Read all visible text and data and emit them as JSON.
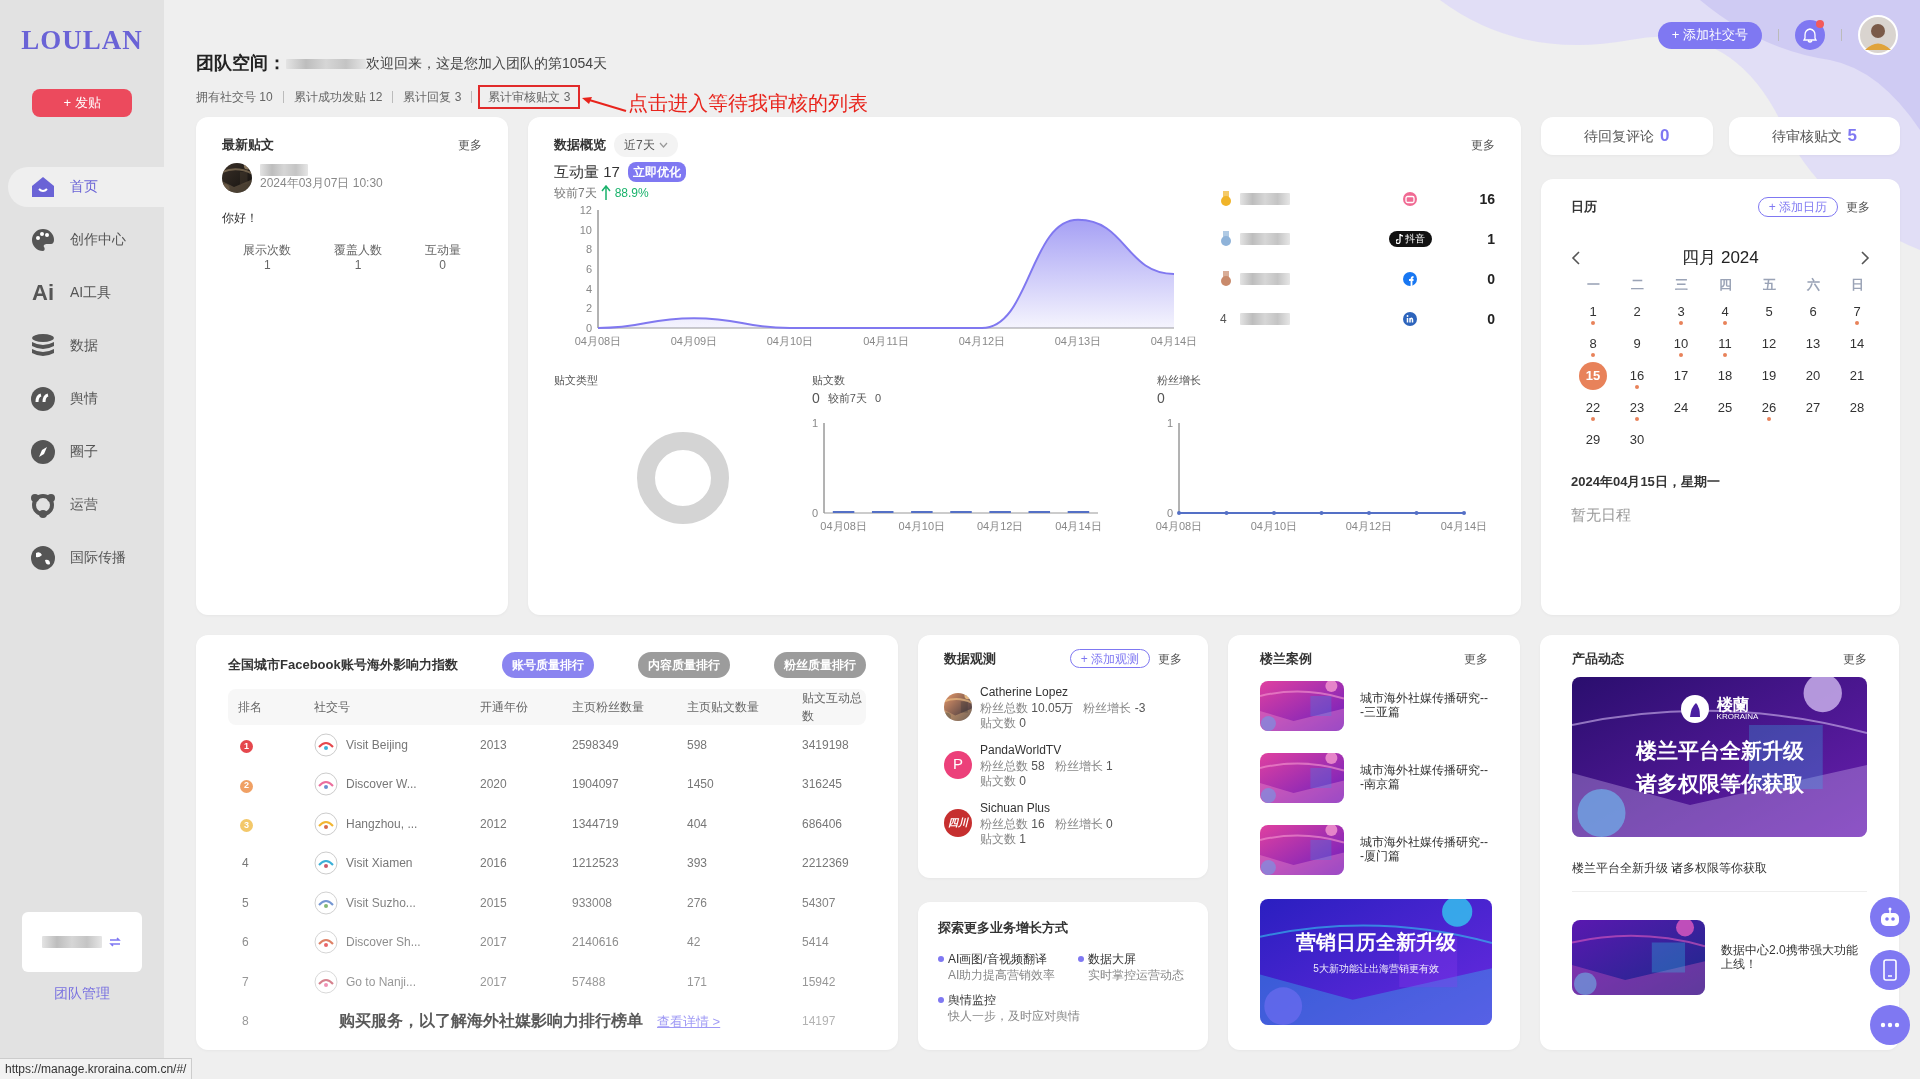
{
  "sidebar": {
    "logo": "LOULAN",
    "post_button": "+ 发贴",
    "items": [
      {
        "label": "首页",
        "selected": true
      },
      {
        "label": "创作中心",
        "selected": false
      },
      {
        "label": "AI工具",
        "selected": false,
        "glyph": "Ai"
      },
      {
        "label": "数据",
        "selected": false
      },
      {
        "label": "舆情",
        "selected": false
      },
      {
        "label": "圈子",
        "selected": false
      },
      {
        "label": "运营",
        "selected": false
      },
      {
        "label": "国际传播",
        "selected": false
      }
    ],
    "team_link": "团队管理"
  },
  "topbar": {
    "add_button": "+ 添加社交号",
    "unread": true
  },
  "header": {
    "title": "团队空间：",
    "welcome": "欢迎回来，这是您加入团队的第1054天",
    "stats": [
      {
        "text": "拥有社交号 10",
        "highlighted": false
      },
      {
        "text": "累计成功发贴 12",
        "highlighted": false
      },
      {
        "text": "累计回复 3",
        "highlighted": false
      },
      {
        "text": "累计审核贴文 3",
        "highlighted": true
      }
    ],
    "annotation": "点击进入等待我审核的列表"
  },
  "latest_post": {
    "title": "最新贴文",
    "more": "更多",
    "time": "2024年03月07日 10:30",
    "content": "你好！",
    "metrics": [
      {
        "label": "展示次数",
        "value": "1"
      },
      {
        "label": "覆盖人数",
        "value": "1"
      },
      {
        "label": "互动量",
        "value": "0"
      }
    ]
  },
  "overview": {
    "title": "数据概览",
    "range": "近7天",
    "more": "更多",
    "metric_label": "互动量 17",
    "optimize_button": "立即优化",
    "compare_label": "较前7天",
    "change": "88.9%",
    "rising": true,
    "chart_data": {
      "type": "area",
      "categories": [
        "04月08日",
        "04月09日",
        "04月10日",
        "04月11日",
        "04月12日",
        "04月13日",
        "04月14日"
      ],
      "series": [
        {
          "color": "#8078f0",
          "values": [
            0,
            1,
            0,
            0,
            0,
            11,
            5.5
          ]
        }
      ],
      "ylim": [
        0,
        12
      ],
      "yticks": [
        0,
        2,
        4,
        6,
        8,
        10,
        12
      ]
    },
    "leaderboard": [
      {
        "kind": "medal",
        "color": "#f0b429",
        "platform": {
          "kind": "tv"
        },
        "value": "16"
      },
      {
        "kind": "medal",
        "color": "#8fb3d9",
        "platform": {
          "kind": "douyin",
          "badge_text": "抖音"
        },
        "value": "1"
      },
      {
        "kind": "medal",
        "color": "#c98a6b",
        "platform": {
          "kind": "facebook"
        },
        "value": "0"
      },
      {
        "kind": "number",
        "rank": "4",
        "platform": {
          "kind": "linkedin"
        },
        "value": "0"
      }
    ],
    "post_type": {
      "title": "贴文类型"
    },
    "post_count": {
      "title": "贴文数",
      "value": "0",
      "compare_label": "较前7天",
      "compare_value": "0",
      "chart_data": {
        "type": "bar",
        "categories": [
          "04月08日",
          null,
          "04月10日",
          null,
          "04月12日",
          null,
          "04月14日"
        ],
        "series": [
          {
            "color": "#5470c6",
            "values": [
              0,
              0,
              0,
              0,
              0,
              0,
              0
            ]
          }
        ],
        "ylim": [
          0,
          1
        ],
        "yticks": [
          0,
          1
        ]
      }
    },
    "fan_growth": {
      "title": "粉丝增长",
      "value": "0",
      "chart_data": {
        "type": "line",
        "categories": [
          "04月08日",
          null,
          "04月10日",
          null,
          "04月12日",
          null,
          "04月14日"
        ],
        "series": [
          {
            "color": "#5470c6",
            "values": [
              0,
              0,
              0,
              0,
              0,
              0,
              0
            ]
          }
        ],
        "ylim": [
          0,
          1
        ],
        "yticks": [
          0,
          1
        ]
      }
    }
  },
  "pending": [
    {
      "label": "待回复评论",
      "value": "0"
    },
    {
      "label": "待审核贴文",
      "value": "5"
    }
  ],
  "calendar": {
    "title": "日历",
    "add_button": "+ 添加日历",
    "more": "更多",
    "month": "四月 2024",
    "weekdays": [
      "一",
      "二",
      "三",
      "四",
      "五",
      "六",
      "日"
    ],
    "days": [
      {
        "day": "1",
        "dot": true,
        "selected": false
      },
      {
        "day": "2",
        "dot": false,
        "selected": false
      },
      {
        "day": "3",
        "dot": true,
        "selected": false
      },
      {
        "day": "4",
        "dot": true,
        "selected": false
      },
      {
        "day": "5",
        "dot": false,
        "selected": false
      },
      {
        "day": "6",
        "dot": false,
        "selected": false
      },
      {
        "day": "7",
        "dot": true,
        "selected": false
      },
      {
        "day": "8",
        "dot": true,
        "selected": false
      },
      {
        "day": "9",
        "dot": false,
        "selected": false
      },
      {
        "day": "10",
        "dot": true,
        "selected": false
      },
      {
        "day": "11",
        "dot": true,
        "selected": false
      },
      {
        "day": "12",
        "dot": false,
        "selected": false
      },
      {
        "day": "13",
        "dot": false,
        "selected": false
      },
      {
        "day": "14",
        "dot": false,
        "selected": false
      },
      {
        "day": "15",
        "dot": false,
        "selected": true
      },
      {
        "day": "16",
        "dot": true,
        "selected": false
      },
      {
        "day": "17",
        "dot": false,
        "selected": false
      },
      {
        "day": "18",
        "dot": false,
        "selected": false
      },
      {
        "day": "19",
        "dot": false,
        "selected": false
      },
      {
        "day": "20",
        "dot": false,
        "selected": false
      },
      {
        "day": "21",
        "dot": false,
        "selected": false
      },
      {
        "day": "22",
        "dot": true,
        "selected": false
      },
      {
        "day": "23",
        "dot": true,
        "selected": false
      },
      {
        "day": "24",
        "dot": false,
        "selected": false
      },
      {
        "day": "25",
        "dot": false,
        "selected": false
      },
      {
        "day": "26",
        "dot": true,
        "selected": false
      },
      {
        "day": "27",
        "dot": false,
        "selected": false
      },
      {
        "day": "28",
        "dot": false,
        "selected": false
      },
      {
        "day": "29",
        "dot": false,
        "selected": false
      },
      {
        "day": "30",
        "dot": false,
        "selected": false
      }
    ],
    "date_label": "2024年04月15日，星期一",
    "empty": "暂无日程"
  },
  "ranking": {
    "title": "全国城市Facebook账号海外影响力指数",
    "tabs": [
      {
        "label": "账号质量排行",
        "selected": true
      },
      {
        "label": "内容质量排行",
        "selected": false
      },
      {
        "label": "粉丝质量排行",
        "selected": false
      }
    ],
    "columns": [
      "排名",
      "社交号",
      "开通年份",
      "主页粉丝数量",
      "主页贴文数量",
      "贴文互动总数"
    ],
    "rows": [
      {
        "rank": "1",
        "color": "#e5484d",
        "name": "Visit Beijing",
        "year": "2013",
        "fans": "2598349",
        "posts": "598",
        "interactions": "3419198"
      },
      {
        "rank": "2",
        "color": "#f0a064",
        "name": "Discover W...",
        "year": "2020",
        "fans": "1904097",
        "posts": "1450",
        "interactions": "316245"
      },
      {
        "rank": "3",
        "color": "#f3c86a",
        "name": "Hangzhou, ...",
        "year": "2012",
        "fans": "1344719",
        "posts": "404",
        "interactions": "686406"
      },
      {
        "rank": "4",
        "name": "Visit Xiamen",
        "year": "2016",
        "fans": "1212523",
        "posts": "393",
        "interactions": "2212369"
      },
      {
        "rank": "5",
        "name": "Visit Suzho...",
        "year": "2015",
        "fans": "933008",
        "posts": "276",
        "interactions": "54307"
      },
      {
        "rank": "6",
        "name": "Discover Sh...",
        "year": "2017",
        "fans": "2140616",
        "posts": "42",
        "interactions": "5414"
      },
      {
        "rank": "7",
        "name": "Go to Nanji...",
        "year": "2017",
        "fans": "57488",
        "posts": "171",
        "interactions": "15942"
      },
      {
        "rank": "8",
        "interactions": "14197"
      }
    ],
    "promo": "购买服务，以了解海外社媒影响力排行榜单",
    "promo_link": "查看详情 >"
  },
  "observation": {
    "title": "数据观测",
    "add_button": "+ 添加观测",
    "more": "更多",
    "accounts": [
      {
        "name": "Catherine Lopez",
        "fans": {
          "label": "粉丝总数",
          "value": "10.05万"
        },
        "growth": {
          "label": "粉丝增长",
          "value": "-3"
        },
        "posts": {
          "label": "贴文数",
          "value": "0"
        }
      },
      {
        "name": "PandaWorldTV",
        "avatar": {
          "kind": "letter",
          "text": "P",
          "color": "#ec407a"
        },
        "fans": {
          "label": "粉丝总数",
          "value": "58"
        },
        "growth": {
          "label": "粉丝增长",
          "value": "1"
        },
        "posts": {
          "label": "贴文数",
          "value": "0"
        }
      },
      {
        "name": "Sichuan Plus",
        "avatar": {
          "kind": "logo",
          "text": "四川",
          "color": "#c62f2f"
        },
        "fans": {
          "label": "粉丝总数",
          "value": "16"
        },
        "growth": {
          "label": "粉丝增长",
          "value": "0"
        },
        "posts": {
          "label": "贴文数",
          "value": "1"
        }
      }
    ]
  },
  "explore": {
    "title": "探索更多业务增长方式",
    "items": [
      {
        "title": "AI画图/音视频翻译",
        "subtitle": "AI助力提高营销效率"
      },
      {
        "title": "数据大屏",
        "subtitle": "实时掌控运营动态"
      },
      {
        "title": "舆情监控",
        "subtitle": "快人一步，及时应对舆情"
      }
    ]
  },
  "cases": {
    "title": "楼兰案例",
    "more": "更多",
    "items": [
      {
        "title": "城市海外社媒传播研究---三亚篇"
      },
      {
        "title": "城市海外社媒传播研究---南京篇"
      },
      {
        "title": "城市海外社媒传播研究---厦门篇"
      }
    ],
    "banner": {
      "title": "营销日历全新升级",
      "subtitle": "5大新功能让出海营销更有效"
    }
  },
  "product": {
    "title": "产品动态",
    "more": "更多",
    "banner": {
      "logo": "楼蘭",
      "logo_sub": "KRORAINA",
      "headline": [
        "楼兰平台全新升级",
        "诸多权限等你获取"
      ]
    },
    "caption": "楼兰平台全新升级 诸多权限等你获取",
    "items": [
      {
        "title": "数据中心2.0携带强大功能上线！"
      }
    ]
  },
  "status_bar": "https://manage.kroraina.com.cn/#/"
}
